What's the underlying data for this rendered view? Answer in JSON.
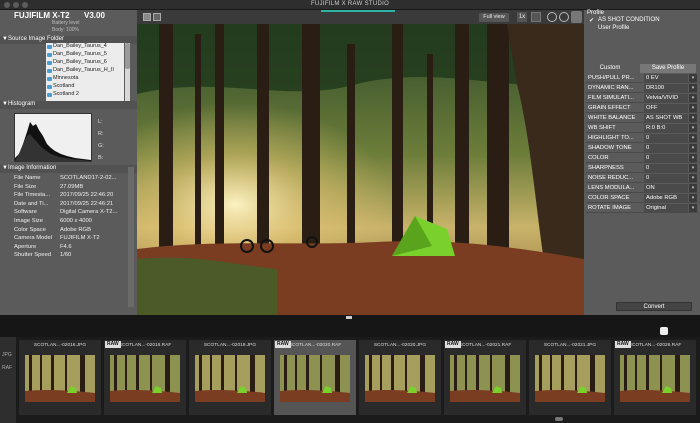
{
  "app": {
    "title": "FUJIFILM X RAW STUDIO"
  },
  "left": {
    "camera_name": "FUJIFILM X-T2",
    "firmware": "V3.00",
    "battery_label": "Battery level",
    "body_label": "Body: 100%",
    "source_folder_header": "▼Source Image Folder",
    "folders": [
      {
        "name": "Dan_Bailey_Taurus_4",
        "selected": false
      },
      {
        "name": "Dan_Bailey_Taurus_5",
        "selected": false
      },
      {
        "name": "Dan_Bailey_Taurus_6",
        "selected": false
      },
      {
        "name": "Dan_Bailey_Taurus_H_II",
        "selected": false
      },
      {
        "name": "Minnesota",
        "selected": false
      },
      {
        "name": "Scotland",
        "selected": false
      },
      {
        "name": "Scotland 2",
        "selected": false
      }
    ],
    "histogram_header": "▼Histogram",
    "hist_labels": [
      "L:",
      "R:",
      "G:",
      "B:"
    ],
    "image_info_header": "▼Image Information",
    "info": [
      {
        "k": "File Name",
        "v": "SCOTLAND17-2-02..."
      },
      {
        "k": "File Size",
        "v": "27.09MB"
      },
      {
        "k": "File Timesta...",
        "v": "2017/09/25 22:46:20"
      },
      {
        "k": "Date and Ti...",
        "v": "2017/09/25 22:46:21"
      },
      {
        "k": "Software",
        "v": "Digital Camera X-T2..."
      },
      {
        "k": "Image Size",
        "v": "6000 x 4000"
      },
      {
        "k": "Color Space",
        "v": "Adobe RGB"
      },
      {
        "k": "Camera Model",
        "v": "FUJIFILM X-T2"
      },
      {
        "k": "Aperture",
        "v": "F4.6"
      },
      {
        "k": "Shutter Speed",
        "v": "1/60"
      }
    ]
  },
  "viewer": {
    "view_mode": "Full view",
    "fit_label": "1x"
  },
  "right": {
    "profile_header": "Profile",
    "as_shot": "AS SHOT CONDITION",
    "user_profile": "User Profile",
    "custom_label": "Custom",
    "save_profile": "Save Profile",
    "params": [
      {
        "name": "PUSH/PULL PR...",
        "value": "0 EV"
      },
      {
        "name": "DYNAMIC RAN...",
        "value": "DR100"
      },
      {
        "name": "FILM SIMULATI...",
        "value": "Velvia/VIVID"
      },
      {
        "name": "GRAIN EFFECT",
        "value": "OFF"
      },
      {
        "name": "WHITE BALANCE",
        "value": "AS SHOT WB"
      },
      {
        "name": "WB SHIFT",
        "value": "R:0 B:0"
      },
      {
        "name": "HIGHLIGHT TO...",
        "value": "0"
      },
      {
        "name": "SHADOW TONE",
        "value": "0"
      },
      {
        "name": "COLOR",
        "value": "0"
      },
      {
        "name": "SHARPNESS",
        "value": "0"
      },
      {
        "name": "NOISE REDUC...",
        "value": "0"
      },
      {
        "name": "LENS MODULA...",
        "value": "ON"
      },
      {
        "name": "COLOR SPACE",
        "value": "Adobe RGB"
      },
      {
        "name": "ROTATE IMAGE",
        "value": "Original"
      }
    ],
    "convert_label": "Convert"
  },
  "filmstrip": {
    "items": [
      {
        "name": "SCOTLAN...-02016.JPG",
        "raw": false,
        "selected": false
      },
      {
        "name": "SCOTLAN...-02016.RAF",
        "raw": true,
        "selected": false
      },
      {
        "name": "SCOTLAN...-02019.JPG",
        "raw": false,
        "selected": false
      },
      {
        "name": "SCOTLAN...-02020.RAF",
        "raw": true,
        "selected": true
      },
      {
        "name": "SCOTLAN...-02020.JPG",
        "raw": false,
        "selected": false
      },
      {
        "name": "SCOTLAN...-02021.RAF",
        "raw": true,
        "selected": false
      },
      {
        "name": "SCOTLAN...-02021.JPG",
        "raw": false,
        "selected": false
      },
      {
        "name": "SCOTLAN...-02026.RAF",
        "raw": true,
        "selected": false
      }
    ],
    "raw_badge": "RAW",
    "side_labels": [
      "JPG",
      "RAF"
    ]
  }
}
